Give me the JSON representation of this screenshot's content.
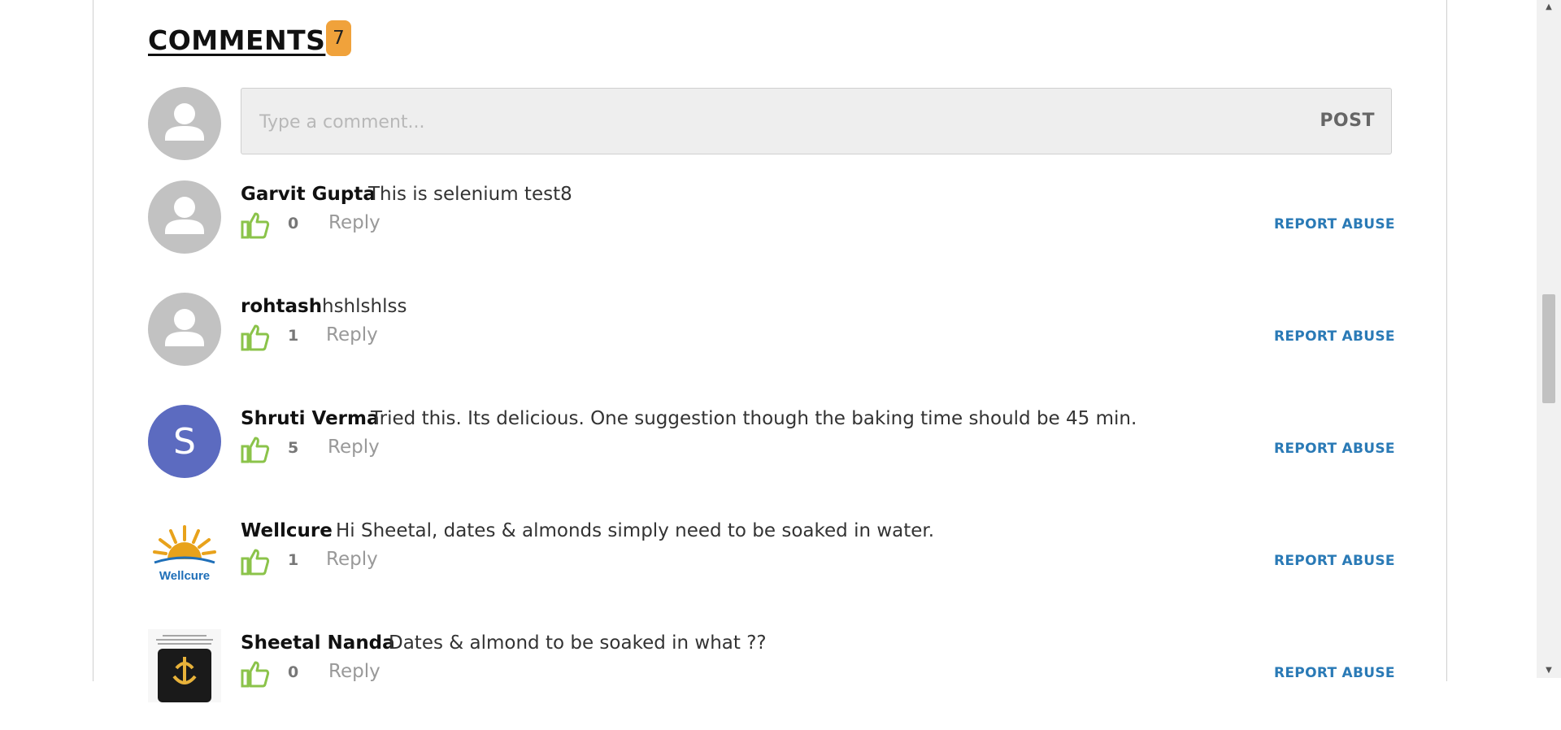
{
  "header": {
    "title": "COMMENTS",
    "count": "7"
  },
  "composer": {
    "placeholder": "Type a comment...",
    "post_label": "POST"
  },
  "comments": [
    {
      "author": "Garvit Gupta",
      "text": "This is selenium test8",
      "likes": "0",
      "reply": "Reply",
      "report": "REPORT ABUSE",
      "avatar": "default-user-icon"
    },
    {
      "author": "rohtash",
      "text": "hshlshlss",
      "likes": "1",
      "reply": "Reply",
      "report": "REPORT ABUSE",
      "avatar": "default-user-icon"
    },
    {
      "author": "Shruti Verma",
      "text": "Tried this. Its delicious. One suggestion though the baking time should be 45 min.",
      "likes": "5",
      "reply": "Reply",
      "report": "REPORT ABUSE",
      "avatar_letter": "S"
    },
    {
      "author": "Wellcure",
      "text": "Hi Sheetal, dates & almonds simply need to be soaked in water.",
      "likes": "1",
      "reply": "Reply",
      "report": "REPORT ABUSE",
      "avatar_logo_text": "Wellcure"
    },
    {
      "author": "Sheetal Nanda",
      "text": "Dates & almond to be soaked in what ??",
      "likes": "0",
      "reply": "Reply",
      "report": "REPORT ABUSE",
      "avatar": "profile-photo"
    }
  ],
  "colors": {
    "badge": "#f0a23b",
    "like_icon": "#8bc34a",
    "report_link": "#2a7ab6",
    "letter_avatar": "#5c6bc0"
  }
}
